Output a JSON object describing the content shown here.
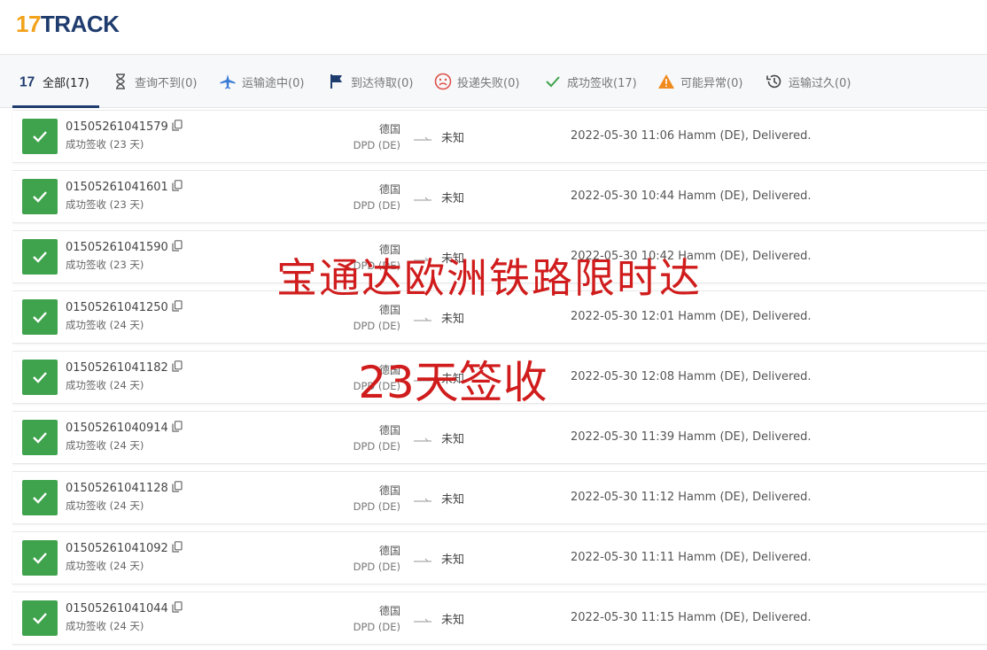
{
  "app": {
    "logo_prefix": "17",
    "logo_text": "TRACK"
  },
  "tabs": [
    {
      "label": "全部(17)",
      "icon": "17-logo-icon",
      "active": true
    },
    {
      "label": "查询不到(0)",
      "icon": "hourglass-icon"
    },
    {
      "label": "运输途中(0)",
      "icon": "airplane-icon"
    },
    {
      "label": "到达待取(0)",
      "icon": "flag-icon"
    },
    {
      "label": "投递失败(0)",
      "icon": "sad-face-icon"
    },
    {
      "label": "成功签收(17)",
      "icon": "check-icon"
    },
    {
      "label": "可能异常(0)",
      "icon": "warning-icon"
    },
    {
      "label": "运输过久(0)",
      "icon": "clock-history-icon"
    }
  ],
  "colors": {
    "brand": "#1f3c6e",
    "accent": "#f2a21b",
    "success": "#3fa34d",
    "overlay_red": "#d01c1c"
  },
  "shipments": [
    {
      "tracking": "01505261041579",
      "status": "成功签收 (23 天)",
      "origin": "德国",
      "carrier": "DPD (DE)",
      "destination": "未知",
      "event": "2022-05-30 11:06  Hamm (DE), Delivered."
    },
    {
      "tracking": "01505261041601",
      "status": "成功签收 (23 天)",
      "origin": "德国",
      "carrier": "DPD (DE)",
      "destination": "未知",
      "event": "2022-05-30 10:44  Hamm (DE), Delivered."
    },
    {
      "tracking": "01505261041590",
      "status": "成功签收 (23 天)",
      "origin": "德国",
      "carrier": "DPD (DE)",
      "destination": "未知",
      "event": "2022-05-30 10:42  Hamm (DE), Delivered."
    },
    {
      "tracking": "01505261041250",
      "status": "成功签收 (24 天)",
      "origin": "德国",
      "carrier": "DPD (DE)",
      "destination": "未知",
      "event": "2022-05-30 12:01  Hamm (DE), Delivered."
    },
    {
      "tracking": "01505261041182",
      "status": "成功签收 (24 天)",
      "origin": "德国",
      "carrier": "DPD (DE)",
      "destination": "未知",
      "event": "2022-05-30 12:08  Hamm (DE), Delivered."
    },
    {
      "tracking": "01505261040914",
      "status": "成功签收 (24 天)",
      "origin": "德国",
      "carrier": "DPD (DE)",
      "destination": "未知",
      "event": "2022-05-30 11:39  Hamm (DE), Delivered."
    },
    {
      "tracking": "01505261041128",
      "status": "成功签收 (24 天)",
      "origin": "德国",
      "carrier": "DPD (DE)",
      "destination": "未知",
      "event": "2022-05-30 11:12  Hamm (DE), Delivered."
    },
    {
      "tracking": "01505261041092",
      "status": "成功签收 (24 天)",
      "origin": "德国",
      "carrier": "DPD (DE)",
      "destination": "未知",
      "event": "2022-05-30 11:11  Hamm (DE), Delivered."
    },
    {
      "tracking": "01505261041044",
      "status": "成功签收 (24 天)",
      "origin": "德国",
      "carrier": "DPD (DE)",
      "destination": "未知",
      "event": "2022-05-30 11:15  Hamm (DE), Delivered."
    }
  ],
  "overlay": {
    "line1": "宝通达欧洲铁路限时达",
    "line2": "23天签收"
  }
}
